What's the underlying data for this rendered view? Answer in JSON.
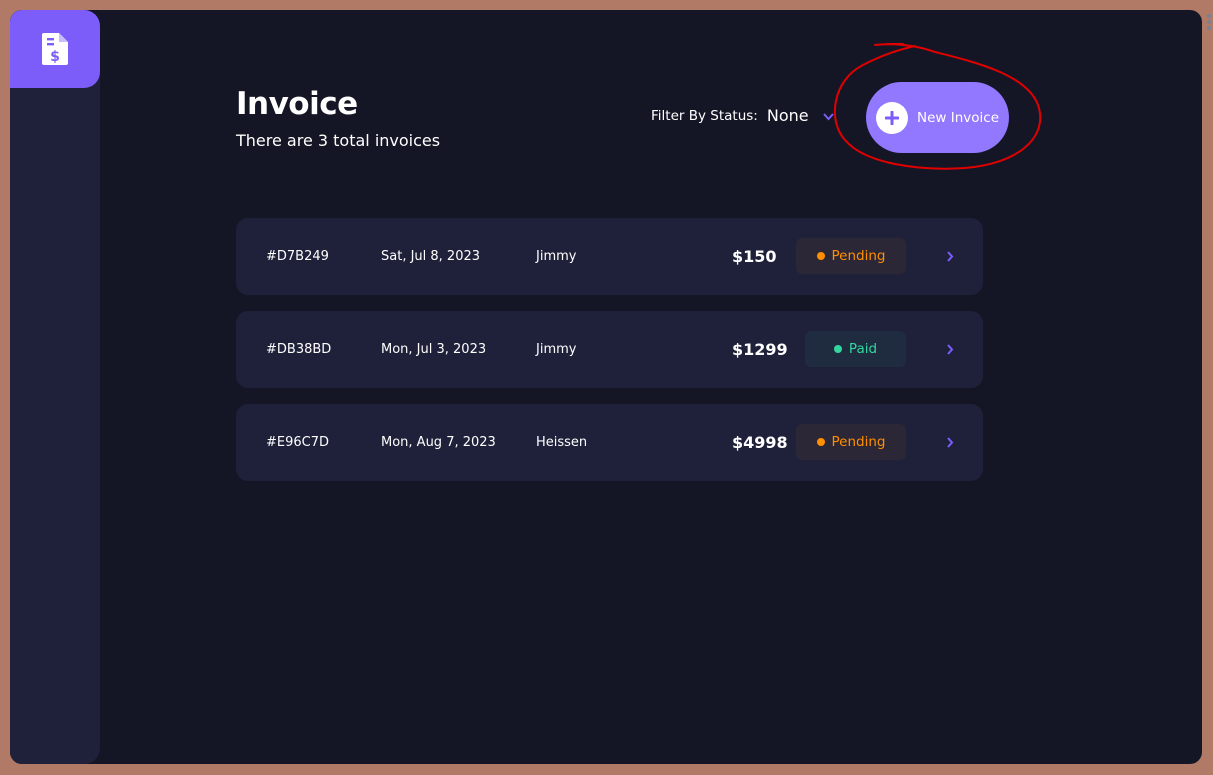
{
  "app": {
    "logo_icon": "invoice-dollar-icon",
    "accent": "#7c5dfa"
  },
  "header": {
    "title": "Invoice",
    "subtitle": "There are 3 total invoices",
    "filter_label": "Filter By Status:",
    "filter_value": "None",
    "new_invoice_label": "New Invoice"
  },
  "invoices": [
    {
      "id": "#D7B249",
      "date": "Sat, Jul 8, 2023",
      "client": "Jimmy",
      "amount": "$150",
      "status": "Pending"
    },
    {
      "id": "#DB38BD",
      "date": "Mon, Jul 3, 2023",
      "client": "Jimmy",
      "amount": "$1299",
      "status": "Paid"
    },
    {
      "id": "#E96C7D",
      "date": "Mon, Aug 7, 2023",
      "client": "Heissen",
      "amount": "$4998",
      "status": "Pending"
    }
  ],
  "colors": {
    "background": "#141625",
    "card": "#1e2139",
    "accent": "#7c5dfa",
    "button": "#9277ff",
    "pending": "#ff8f00",
    "paid": "#33d69f",
    "annotation": "#e00000"
  }
}
